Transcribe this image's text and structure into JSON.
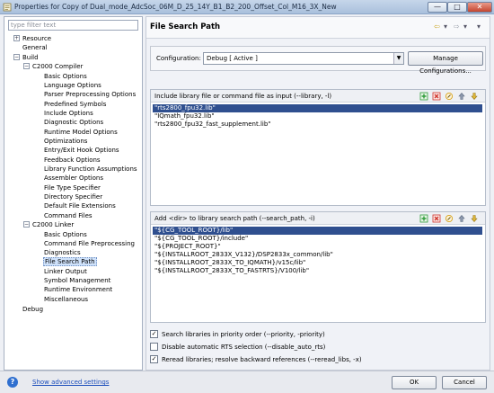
{
  "window": {
    "title": "Properties for Copy of Dual_mode_AdcSoc_06M_D_25_14Y_B1_B2_200_Offset_Col_M16_3X_New",
    "minimize": "—",
    "maximize": "□",
    "close": "✕"
  },
  "sidebar": {
    "filter_placeholder": "type filter text",
    "items": [
      {
        "label": "Resource",
        "expander": "+"
      },
      {
        "label": "General"
      },
      {
        "label": "Build",
        "expander": "−"
      },
      {
        "label": "C2000 Compiler",
        "expander": "−"
      },
      {
        "label": "Basic Options"
      },
      {
        "label": "Language Options"
      },
      {
        "label": "Parser Preprocessing Options"
      },
      {
        "label": "Predefined Symbols"
      },
      {
        "label": "Include Options"
      },
      {
        "label": "Diagnostic Options"
      },
      {
        "label": "Runtime Model Options"
      },
      {
        "label": "Optimizations"
      },
      {
        "label": "Entry/Exit Hook Options"
      },
      {
        "label": "Feedback Options"
      },
      {
        "label": "Library Function Assumptions"
      },
      {
        "label": "Assembler Options"
      },
      {
        "label": "File Type Specifier"
      },
      {
        "label": "Directory Specifier"
      },
      {
        "label": "Default File Extensions"
      },
      {
        "label": "Command Files"
      },
      {
        "label": "C2000 Linker",
        "expander": "−"
      },
      {
        "label": "Basic Options"
      },
      {
        "label": "Command File Preprocessing"
      },
      {
        "label": "Diagnostics"
      },
      {
        "label": "File Search Path"
      },
      {
        "label": "Linker Output"
      },
      {
        "label": "Symbol Management"
      },
      {
        "label": "Runtime Environment"
      },
      {
        "label": "Miscellaneous"
      },
      {
        "label": "Debug"
      }
    ]
  },
  "main": {
    "title": "File Search Path",
    "nav": {
      "back": "⇦",
      "back_menu": "▾",
      "forward": "⇨",
      "forward_menu": "▾",
      "view_menu": "▾"
    },
    "configuration": {
      "label": "Configuration:",
      "value": "Debug  [ Active ]",
      "arrow": "▼",
      "manage_label": "Manage Configurations..."
    },
    "include_list": {
      "header": "Include library file or command file as input (--library, -l)",
      "items": [
        "\"rts2800_fpu32.lib\"",
        "\"IQmath_fpu32.lib\"",
        "\"rts2800_fpu32_fast_supplement.lib\""
      ]
    },
    "search_list": {
      "header": "Add <dir> to library search path (--search_path, -i)",
      "items": [
        "\"${CG_TOOL_ROOT}/lib\"",
        "\"${CG_TOOL_ROOT}/include\"",
        "\"${PROJECT_ROOT}\"",
        "\"${INSTALLROOT_2833X_V132}/DSP2833x_common/lib\"",
        "\"${INSTALLROOT_2833X_TO_IQMATH}/v15c/lib\"",
        "\"${INSTALLROOT_2833X_TO_FASTRTS}/V100/lib\""
      ]
    },
    "options": [
      {
        "label": "Search libraries in priority order (--priority, -priority)",
        "checked": true
      },
      {
        "label": "Disable automatic RTS selection (--disable_auto_rts)",
        "checked": false
      },
      {
        "label": "Reread libraries; resolve backward references (--reread_libs, -x)",
        "checked": true
      }
    ]
  },
  "footer": {
    "help": "?",
    "advanced_link": "Show advanced settings",
    "ok": "OK",
    "cancel": "Cancel"
  },
  "colors": {
    "accent": "#2f4f8f",
    "link": "#1a4dbb",
    "add": "#2e9b3a",
    "delete": "#d0342c",
    "edit": "#d6a21c"
  }
}
